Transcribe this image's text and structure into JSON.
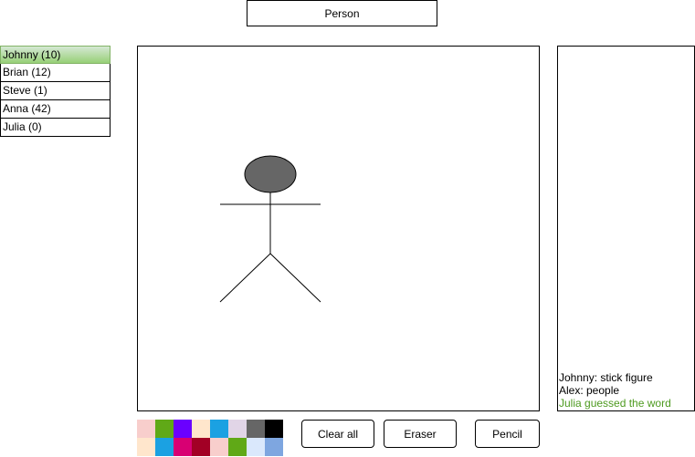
{
  "word": "Person",
  "players": [
    {
      "label": "Johnny (10)",
      "active": true
    },
    {
      "label": "Brian (12)",
      "active": false
    },
    {
      "label": "Steve (1)",
      "active": false
    },
    {
      "label": "Anna (42)",
      "active": false
    },
    {
      "label": "Julia (0)",
      "active": false
    }
  ],
  "chat": {
    "messages": [
      {
        "text": "Johnny: stick figure",
        "type": "user"
      },
      {
        "text": "Alex: people",
        "type": "user"
      },
      {
        "text": "Julia guessed the word",
        "type": "system"
      }
    ]
  },
  "palette": {
    "colors": [
      "#f8cecc",
      "#60a917",
      "#6a00ff",
      "#ffe6cc",
      "#1ba1e2",
      "#e1d5e7",
      "#666666",
      "#000000",
      "#ffe6cc",
      "#1ba1e2",
      "#d80073",
      "#a20025",
      "#f8cecc",
      "#60a917",
      "#dae8fc",
      "#7ea6e0"
    ]
  },
  "toolbar": {
    "clear_label": "Clear all",
    "eraser_label": "Eraser",
    "pencil_label": "Pencil"
  },
  "drawing": {
    "subject": "stick figure",
    "head_fill": "#666666",
    "stroke": "#000000"
  }
}
